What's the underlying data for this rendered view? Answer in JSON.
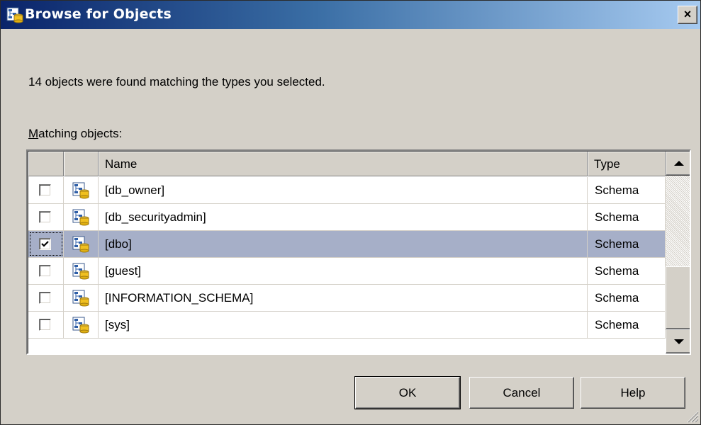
{
  "window": {
    "title": "Browse for Objects",
    "close_glyph": "×"
  },
  "dialog": {
    "found_text": "14 objects were found matching the types you selected.",
    "matching_label_accel": "M",
    "matching_label_rest": "atching objects:"
  },
  "table": {
    "columns": {
      "name": "Name",
      "type": "Type"
    },
    "rows": [
      {
        "checked": false,
        "name": "[db_owner]",
        "type": "Schema",
        "icon": "schema-icon"
      },
      {
        "checked": false,
        "name": "[db_securityadmin]",
        "type": "Schema",
        "icon": "schema-icon"
      },
      {
        "checked": true,
        "name": "[dbo]",
        "type": "Schema",
        "icon": "schema-icon",
        "selected": true
      },
      {
        "checked": false,
        "name": "[guest]",
        "type": "Schema",
        "icon": "schema-icon"
      },
      {
        "checked": false,
        "name": "[INFORMATION_SCHEMA]",
        "type": "Schema",
        "icon": "schema-icon"
      },
      {
        "checked": false,
        "name": "[sys]",
        "type": "Schema",
        "icon": "schema-icon"
      }
    ]
  },
  "buttons": {
    "ok": "OK",
    "cancel": "Cancel",
    "help": "Help"
  },
  "colors": {
    "title_start": "#0a246a",
    "title_end": "#a6caf0",
    "selection": "#a6afc8",
    "face": "#d4d0c8"
  }
}
